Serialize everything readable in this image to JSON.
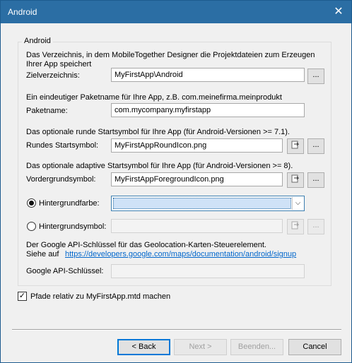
{
  "window": {
    "title": "Android",
    "close_glyph": "✕"
  },
  "group": {
    "legend": "Android",
    "target_dir_desc_line1": "Das Verzeichnis, in dem MobileTogether Designer die Projektdateien zum Erzeugen",
    "target_dir_desc_line2": "Ihrer App speichert",
    "target_dir_label": "Zielverzeichnis:",
    "target_dir_value": "MyFirstApp\\Android",
    "package_desc": "Ein eindeutiger Paketname für Ihre App, z.B. com.meinefirma.meinprodukt",
    "package_label": "Paketname:",
    "package_value": "com.mycompany.myfirstapp",
    "round_icon_desc": "Das optionale runde Startsymbol für Ihre App (für Android-Versionen >= 7.1).",
    "round_icon_label": "Rundes Startsymbol:",
    "round_icon_value": "MyFirstAppRoundIcon.png",
    "adaptive_icon_desc": "Das optionale adaptive Startsymbol für Ihre App (für Android-Versionen >= 8).",
    "foreground_label": "Vordergrundsymbol:",
    "foreground_value": "MyFirstAppForegroundIcon.png",
    "background_color_label": "Hintergrundfarbe:",
    "background_color_selected": true,
    "background_icon_label": "Hintergrundsymbol:",
    "background_icon_selected": false,
    "background_icon_value": "",
    "google_desc_line1": "Der Google API-Schlüssel für das Geolocation-Karten-Steuerelement.",
    "google_desc_line2_prefix": "Siehe auf",
    "google_link": "https://developers.google.com/maps/documentation/android/signup",
    "google_key_label": "Google API-Schlüssel:",
    "google_key_value": "",
    "browse_label": "...",
    "combo_arrow_glyph": "⌵",
    "icons": {
      "open_file": "open-file-icon",
      "close": "close-icon"
    }
  },
  "relative_paths": {
    "label": "Pfade relativ zu MyFirstApp.mtd machen",
    "checked": true,
    "check_glyph": "✓"
  },
  "footer": {
    "back_label": "< Back",
    "next_label": "Next >",
    "finish_label": "Beenden...",
    "cancel_label": "Cancel"
  }
}
